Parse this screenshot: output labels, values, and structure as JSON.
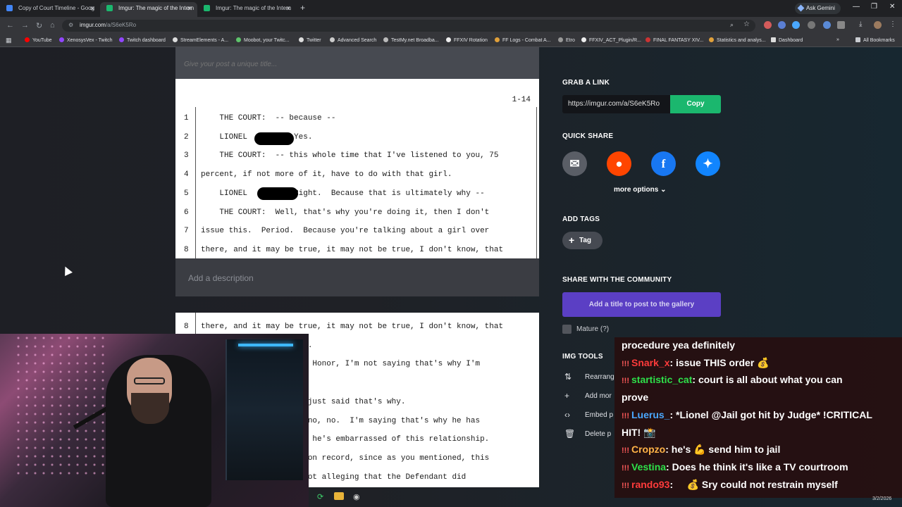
{
  "browser": {
    "tabs": [
      {
        "label": "Copy of Court Timeline - Goog",
        "active": false
      },
      {
        "label": "Imgur: The magic of the Intern",
        "active": true
      },
      {
        "label": "Imgur: The magic of the Intern",
        "active": false
      }
    ],
    "gemini_label": "Ask Gemini",
    "url_host": "imgur.com",
    "url_path": "/a/S6eK5Ro",
    "bookmarks": [
      "YouTube",
      "XenosysVex - Twitch",
      "Twitch dashboard",
      "StreamElements - A...",
      "Moobot, your Twitc...",
      "Twitter",
      "Advanced Search",
      "TestMy.net Broadba...",
      "FFXIV Rotation",
      "FF Logs - Combat A...",
      "Etro",
      "FFXIV_ACT_Plugin/R...",
      "FINAL FANTASY XIV...",
      "Statistics and analys...",
      "Dashboard"
    ],
    "all_bookmarks": "All Bookmarks"
  },
  "editor": {
    "title_placeholder": "Give your post a unique title...",
    "description_placeholder": "Add a description",
    "image1": {
      "page": "1-14",
      "lines": [
        {
          "n": "1",
          "text": "    THE COURT:  -- because --"
        },
        {
          "n": "2",
          "text": "    LIONEL          Yes."
        },
        {
          "n": "3",
          "text": "    THE COURT:  -- this whole time that I've listened to you, 75"
        },
        {
          "n": "4",
          "text": "percent, if not more of it, have to do with that girl."
        },
        {
          "n": "5",
          "text": "    LIONEL          Right.  Because that is ultimately why --"
        },
        {
          "n": "6",
          "text": "    THE COURT:  Well, that's why you're doing it, then I don't"
        },
        {
          "n": "7",
          "text": "issue this.  Period.  Because you're talking about a girl over"
        },
        {
          "n": "8",
          "text": "there, and it may be true, it may not be true, I don't know, that"
        }
      ]
    },
    "image2": {
      "lines": [
        {
          "n": "8",
          "text": "there, and it may be true, it may not be true, I don't know, that"
        },
        {
          "n": "",
          "text": "                    you."
        },
        {
          "n": "",
          "text": "                    our Honor, I'm not saying that's why I'm"
        },
        {
          "n": "",
          "text": ""
        },
        {
          "n": "",
          "text": "                    ou just said that's why."
        },
        {
          "n": "",
          "text": "                    o, no, no.  I'm saying that's why he has"
        },
        {
          "n": "",
          "text": "                    use he's embarrassed of this relationship."
        },
        {
          "n": "",
          "text": "                    fy on record, since as you mentioned, this"
        },
        {
          "n": "",
          "text": "                    m not alleging that the Defendant did"
        }
      ]
    }
  },
  "sidebar": {
    "grab_link_heading": "GRAB A LINK",
    "link_value": "https://imgur.com/a/S6eK5Ro",
    "copy_label": "Copy",
    "quick_share_heading": "QUICK SHARE",
    "more_options": "more options",
    "add_tags_heading": "ADD TAGS",
    "tag_label": "Tag",
    "community_heading": "SHARE WITH THE COMMUNITY",
    "gallery_button": "Add a title to post to the gallery",
    "mature_label": "Mature (?)",
    "img_tools_heading": "IMG TOOLS",
    "tools": [
      "Rearrang",
      "Add mor",
      "Embed p",
      "Delete p"
    ]
  },
  "chat": [
    {
      "user": "",
      "user_color": "#ffffff",
      "text": "procedure yea definitely"
    },
    {
      "user": "Snark_x",
      "user_color": "#ff3b3b",
      "text": ": issue THIS order 💰"
    },
    {
      "user": "startistic_cat",
      "user_color": "#2ee04a",
      "text": ": court is all about what you can"
    },
    {
      "user": "",
      "user_color": "#ffffff",
      "text": "prove"
    },
    {
      "user": "Luerus_",
      "user_color": "#4aa8ff",
      "text": ": *Lionel @Jail got hit by Judge* !CRITICAL"
    },
    {
      "user": "",
      "user_color": "#ffffff",
      "text": "HIT! 📸"
    },
    {
      "user": "Cropzo",
      "user_color": "#ffb347",
      "text": ": he's 💪 send him to jail"
    },
    {
      "user": "Vestina",
      "user_color": "#2ee04a",
      "text": ": Does he think it's like a TV courtroom"
    },
    {
      "user": "rando93",
      "user_color": "#ff3b3b",
      "text": ":     💰 Sry could not restrain myself"
    }
  ],
  "taskbar": {
    "date": "3/2/2026"
  }
}
